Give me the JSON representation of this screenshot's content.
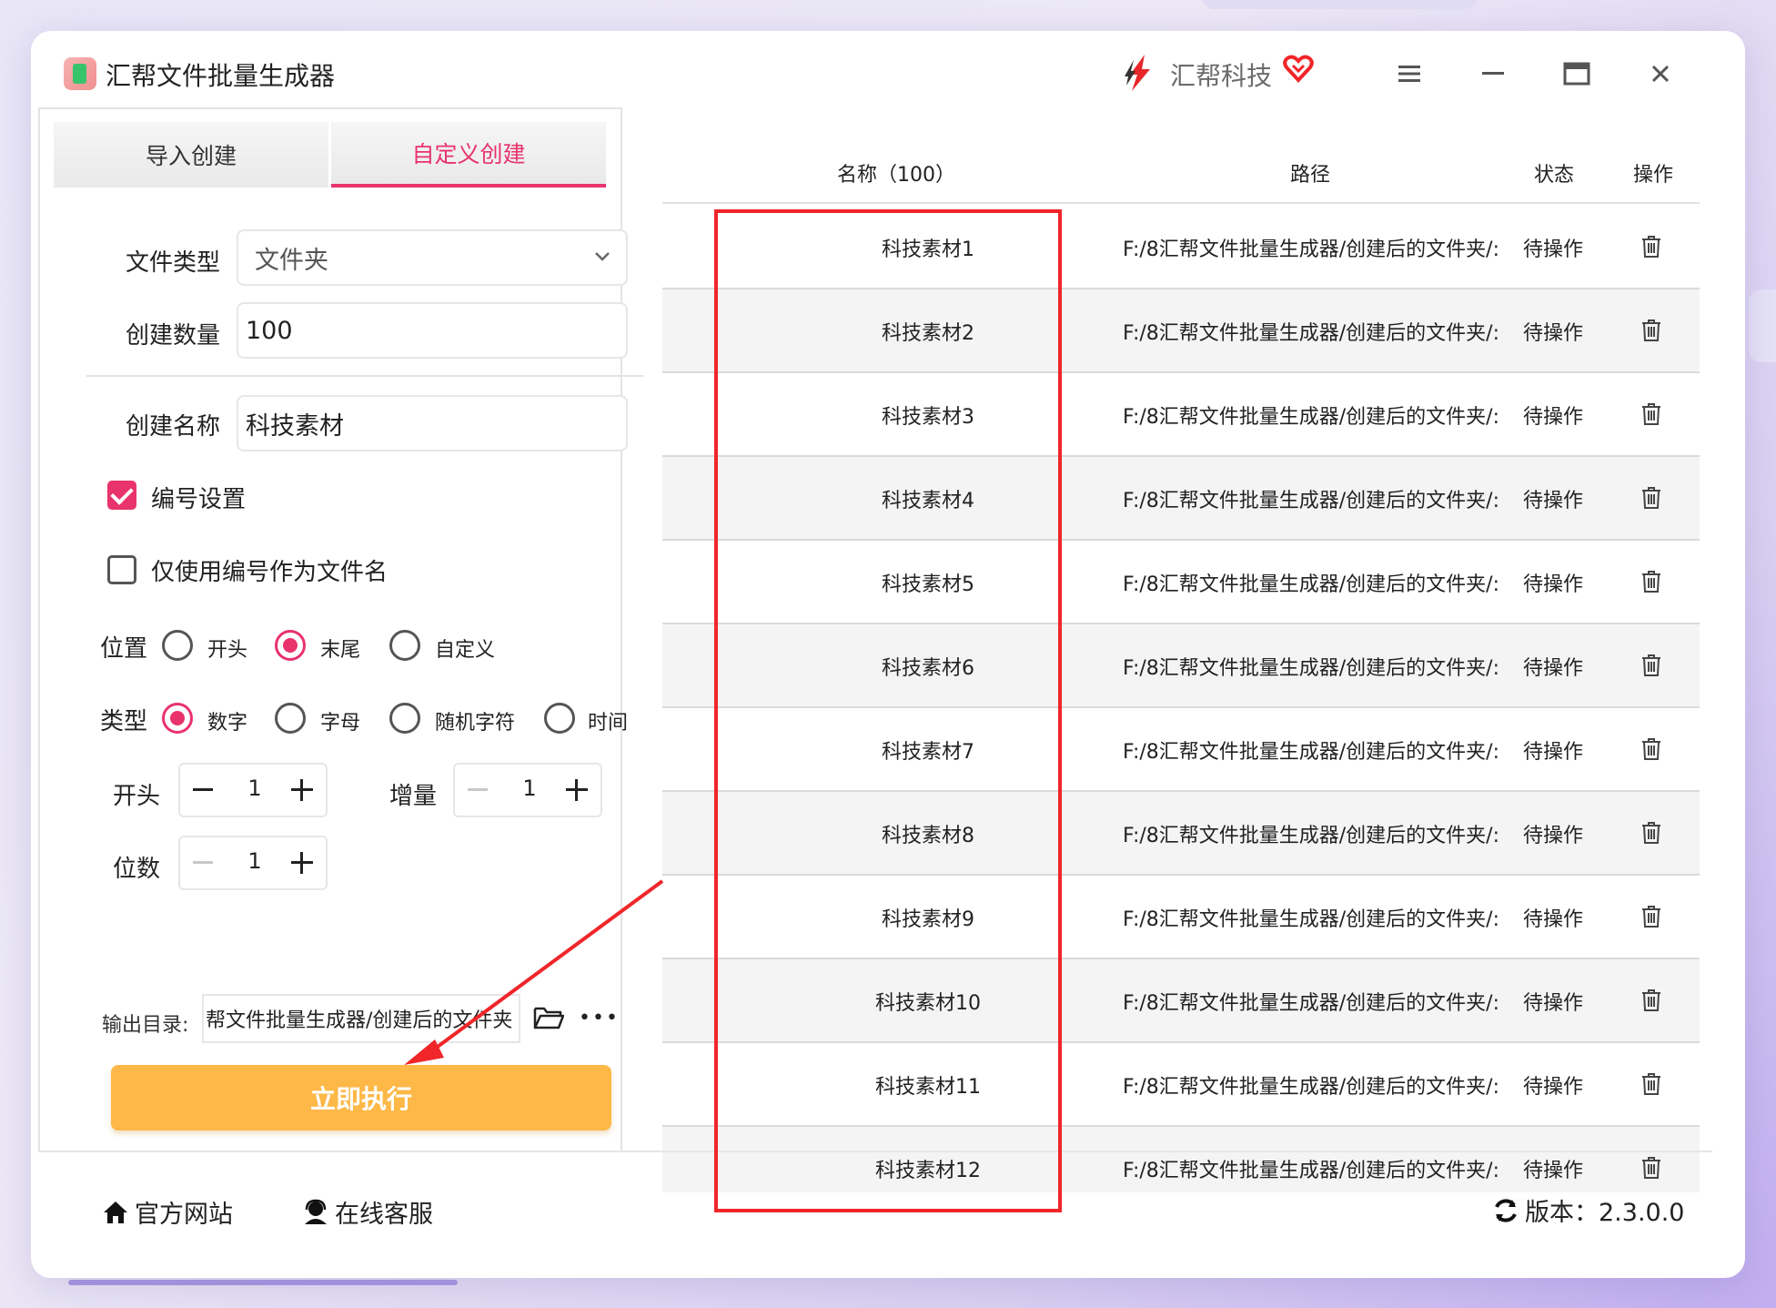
{
  "window": {
    "app_title": "汇帮文件批量生成器",
    "brand_name": "汇帮科技",
    "controls": [
      "menu-icon",
      "minimize-icon",
      "maximize-icon",
      "close-icon"
    ]
  },
  "left_panel": {
    "tabs": [
      {
        "label": "导入创建",
        "active": false
      },
      {
        "label": "自定义创建",
        "active": true
      }
    ],
    "file_type": {
      "label": "文件类型",
      "value": "文件夹"
    },
    "create_count": {
      "label": "创建数量",
      "value": "100"
    },
    "create_name": {
      "label": "创建名称",
      "value": "科技素材"
    },
    "numbering": {
      "label": "编号设置",
      "checked": true
    },
    "only_number": {
      "label": "仅使用编号作为文件名",
      "checked": false
    },
    "position": {
      "label": "位置",
      "options": [
        {
          "label": "开头",
          "selected": false
        },
        {
          "label": "末尾",
          "selected": true
        },
        {
          "label": "自定义",
          "selected": false
        }
      ]
    },
    "type": {
      "label": "类型",
      "options": [
        {
          "label": "数字",
          "selected": true
        },
        {
          "label": "字母",
          "selected": false
        },
        {
          "label": "随机字符",
          "selected": false
        },
        {
          "label": "时间",
          "selected": false
        }
      ]
    },
    "start": {
      "label": "开头",
      "value": "1"
    },
    "increment": {
      "label": "增量",
      "value": "1"
    },
    "digits": {
      "label": "位数",
      "value": "1"
    },
    "output": {
      "label": "输出目录:",
      "value": "帮文件批量生成器/创建后的文件夹"
    },
    "run_button": "立即执行"
  },
  "table": {
    "headers": {
      "name": "名称（100）",
      "path": "路径",
      "status": "状态",
      "action": "操作"
    },
    "rows": [
      {
        "name": "科技素材1",
        "path": "F:/8汇帮文件批量生成器/创建后的文件夹/:",
        "status": "待操作"
      },
      {
        "name": "科技素材2",
        "path": "F:/8汇帮文件批量生成器/创建后的文件夹/:",
        "status": "待操作"
      },
      {
        "name": "科技素材3",
        "path": "F:/8汇帮文件批量生成器/创建后的文件夹/:",
        "status": "待操作"
      },
      {
        "name": "科技素材4",
        "path": "F:/8汇帮文件批量生成器/创建后的文件夹/:",
        "status": "待操作"
      },
      {
        "name": "科技素材5",
        "path": "F:/8汇帮文件批量生成器/创建后的文件夹/:",
        "status": "待操作"
      },
      {
        "name": "科技素材6",
        "path": "F:/8汇帮文件批量生成器/创建后的文件夹/:",
        "status": "待操作"
      },
      {
        "name": "科技素材7",
        "path": "F:/8汇帮文件批量生成器/创建后的文件夹/:",
        "status": "待操作"
      },
      {
        "name": "科技素材8",
        "path": "F:/8汇帮文件批量生成器/创建后的文件夹/:",
        "status": "待操作"
      },
      {
        "name": "科技素材9",
        "path": "F:/8汇帮文件批量生成器/创建后的文件夹/:",
        "status": "待操作"
      },
      {
        "name": "科技素材10",
        "path": "F:/8汇帮文件批量生成器/创建后的文件夹/:",
        "status": "待操作"
      },
      {
        "name": "科技素材11",
        "path": "F:/8汇帮文件批量生成器/创建后的文件夹/:",
        "status": "待操作"
      },
      {
        "name": "科技素材12",
        "path": "F:/8汇帮文件批量生成器/创建后的文件夹/:",
        "status": "待操作"
      }
    ]
  },
  "footer": {
    "website": "官方网站",
    "support": "在线客服",
    "version": "版本：2.3.0.0"
  },
  "colors": {
    "accent": "#e8336d",
    "run_button": "#fdb847",
    "annotation_red": "#f0262a"
  }
}
